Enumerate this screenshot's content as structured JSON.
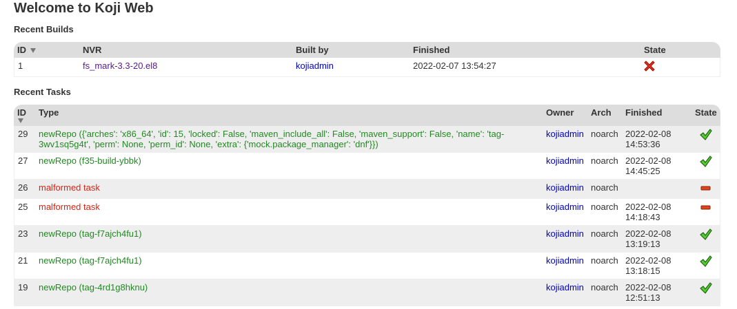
{
  "page": {
    "title": "Welcome to Koji Web"
  },
  "builds": {
    "title": "Recent Builds",
    "columns": {
      "id": "ID",
      "nvr": "NVR",
      "built_by": "Built by",
      "finished": "Finished",
      "state": "State"
    },
    "rows": [
      {
        "id": "1",
        "nvr": "fs_mark-3.3-20.el8",
        "built_by": "kojiadmin",
        "finished": "2022-02-07 13:54:27",
        "state_icon": "failed-icon"
      }
    ]
  },
  "tasks": {
    "title": "Recent Tasks",
    "columns": {
      "id": "ID",
      "type": "Type",
      "owner": "Owner",
      "arch": "Arch",
      "finished": "Finished",
      "state": "State"
    },
    "rows": [
      {
        "id": "29",
        "type": "newRepo ({'arches': 'x86_64', 'id': 15, 'locked': False, 'maven_include_all': False, 'maven_support': False, 'name': 'tag-3wv1sq5g4t', 'perm': None, 'perm_id': None, 'extra': {'mock.package_manager': 'dnf'}})",
        "owner": "kojiadmin",
        "arch": "noarch",
        "finished_date": "2022-02-08",
        "finished_time": "14:53:36",
        "state_icon": "closed-icon"
      },
      {
        "id": "27",
        "type": "newRepo (f35-build-ybbk)",
        "owner": "kojiadmin",
        "arch": "noarch",
        "finished_date": "2022-02-08",
        "finished_time": "14:45:25",
        "state_icon": "closed-icon"
      },
      {
        "id": "26",
        "type": "malformed task",
        "owner": "kojiadmin",
        "arch": "noarch",
        "finished_date": "",
        "finished_time": "",
        "state_icon": "canceled-icon"
      },
      {
        "id": "25",
        "type": "malformed task",
        "owner": "kojiadmin",
        "arch": "noarch",
        "finished_date": "2022-02-08",
        "finished_time": "14:18:43",
        "state_icon": "canceled-icon"
      },
      {
        "id": "23",
        "type": "newRepo (tag-f7ajch4fu1)",
        "owner": "kojiadmin",
        "arch": "noarch",
        "finished_date": "2022-02-08",
        "finished_time": "13:19:13",
        "state_icon": "closed-icon"
      },
      {
        "id": "21",
        "type": "newRepo (tag-f7ajch4fu1)",
        "owner": "kojiadmin",
        "arch": "noarch",
        "finished_date": "2022-02-08",
        "finished_time": "13:18:15",
        "state_icon": "closed-icon"
      },
      {
        "id": "19",
        "type": "newRepo (tag-4rd1g8hknu)",
        "owner": "kojiadmin",
        "arch": "noarch",
        "finished_date": "2022-02-08",
        "finished_time": "12:51:13",
        "state_icon": "closed-icon"
      }
    ]
  },
  "colors": {
    "header_bg": "#dddddd",
    "row_alt_bg": "#eeeeee",
    "task_ok": "#228822",
    "task_failed": "#dd2211",
    "link": "#0000cc",
    "visited": "#551a8b"
  }
}
